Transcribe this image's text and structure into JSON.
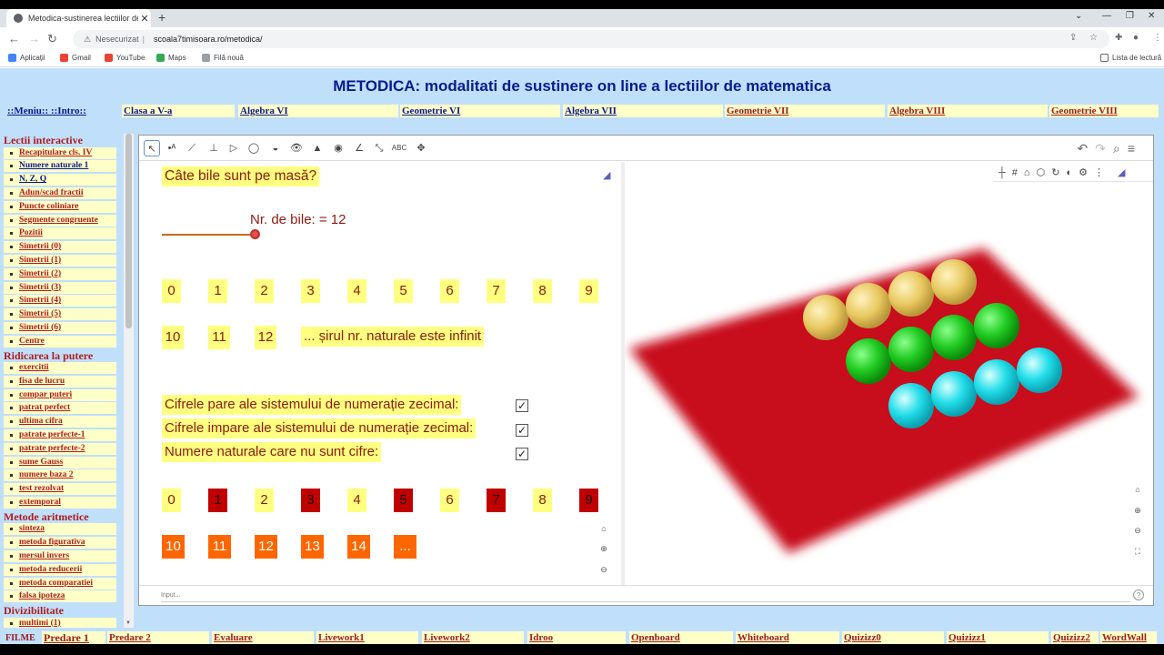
{
  "browser": {
    "tab_title": "Metodica-sustinerea lectiilor de",
    "omnibox_security": "Nesecurizat",
    "omnibox_url": "scoala7timisoara.ro/metodica/",
    "bookmarks": [
      "Aplicații",
      "Gmail",
      "YouTube",
      "Maps",
      "Filă nouă"
    ],
    "reading_list": "Lista de lectură"
  },
  "banner": "METODICA: modalitati de sustinere on line a lectiilor de matematica",
  "topnav": [
    {
      "label": "::Meniu:: ::Intro::",
      "color": "blue"
    },
    {
      "label": "Clasa a V-a",
      "color": "blue"
    },
    {
      "label": "Algebra VI",
      "color": "blue"
    },
    {
      "label": "Geometrie VI",
      "color": "blue"
    },
    {
      "label": "Algebra VII",
      "color": "blue"
    },
    {
      "label": "Geometrie VII",
      "color": "red"
    },
    {
      "label": "Algebra VIII",
      "color": "red"
    },
    {
      "label": "Geometrie VIII",
      "color": "red"
    }
  ],
  "sidebar": {
    "sections": [
      {
        "title": "Lectii interactive",
        "items": [
          {
            "label": "Recapitulare cls. IV",
            "color": "red"
          },
          {
            "label": "Numere naturale 1",
            "color": "blue"
          },
          {
            "label": "N, Z, Q",
            "color": "blue"
          },
          {
            "label": "Adun/scad fractii",
            "color": "red"
          },
          {
            "label": "Puncte coliniare",
            "color": "red"
          },
          {
            "label": "Segmente congruente",
            "color": "red"
          },
          {
            "label": "Pozitii",
            "color": "red"
          },
          {
            "label": "Simetrii (0)",
            "color": "red"
          },
          {
            "label": "Simetrii (1)",
            "color": "red"
          },
          {
            "label": "Simetrii (2)",
            "color": "red"
          },
          {
            "label": "Simetrii (3)",
            "color": "red"
          },
          {
            "label": "Simetrii (4)",
            "color": "red"
          },
          {
            "label": "Simetrii (5)",
            "color": "red"
          },
          {
            "label": "Simetrii (6)",
            "color": "red"
          },
          {
            "label": "Centre",
            "color": "red"
          }
        ]
      },
      {
        "title": "Ridicarea la putere",
        "items": [
          {
            "label": "exercitii",
            "color": "red"
          },
          {
            "label": "fisa de lucru",
            "color": "red"
          },
          {
            "label": "compar puteri",
            "color": "red"
          },
          {
            "label": "patrat perfect",
            "color": "red"
          },
          {
            "label": "ultima cifra",
            "color": "red"
          },
          {
            "label": "patrate perfecte-1",
            "color": "red"
          },
          {
            "label": "patrate perfecte-2",
            "color": "red"
          },
          {
            "label": "sume Gauss",
            "color": "red"
          },
          {
            "label": "numere baza 2",
            "color": "red"
          },
          {
            "label": "test rezolvat",
            "color": "red"
          },
          {
            "label": "extemporal",
            "color": "red"
          }
        ]
      },
      {
        "title": "Metode aritmetice",
        "items": [
          {
            "label": "sinteza",
            "color": "red"
          },
          {
            "label": "metoda figurativa",
            "color": "red"
          },
          {
            "label": "mersul invers",
            "color": "red"
          },
          {
            "label": "metoda reducerii",
            "color": "red"
          },
          {
            "label": "metoda comparatiei",
            "color": "red"
          },
          {
            "label": "falsa ipoteza",
            "color": "red"
          }
        ]
      },
      {
        "title": "Divizibilitate",
        "items": [
          {
            "label": "multimi (1)",
            "color": "red"
          }
        ]
      }
    ]
  },
  "applet": {
    "question": "Câte bile sunt pe masă?",
    "slider_label": "Nr. de bile: = 12",
    "slider_value": 12,
    "row1": [
      "0",
      "1",
      "2",
      "3",
      "4",
      "5",
      "6",
      "7",
      "8",
      "9"
    ],
    "row2": [
      "10",
      "11",
      "12"
    ],
    "infinite_text": "... șirul nr. naturale este infinit",
    "checkboxes": [
      {
        "label": "Cifrele pare ale sistemului de numerație zecimal:",
        "checked": true
      },
      {
        "label": "Cifrele impare ale sistemului de numerație zecimal:",
        "checked": true
      },
      {
        "label": "Numere naturale care nu sunt cifre:",
        "checked": true
      }
    ],
    "row3": [
      "0",
      "1",
      "2",
      "3",
      "4",
      "5",
      "6",
      "7",
      "8",
      "9"
    ],
    "row4": [
      "10",
      "11",
      "12",
      "13",
      "14",
      "..."
    ],
    "input_placeholder": "Input...",
    "colors": {
      "even": "#ffff80",
      "odd": "#c00000",
      "non_digit": "#ff6600",
      "table": "#c8101a"
    },
    "balls": {
      "yellow": 4,
      "green": 4,
      "cyan": 4,
      "yellow_color": "#e8c860",
      "green_color": "#22cc22",
      "cyan_color": "#22dde8"
    }
  },
  "bottomnav": {
    "prefix": "FILME",
    "items": [
      "Predare 1",
      "Predare 2",
      "Evaluare",
      "Livework1",
      "Livework2",
      "Idroo",
      "Openboard",
      "Whiteboard",
      "Quizizz0",
      "Quizizz1",
      "Quizizz2",
      "WordWall"
    ]
  }
}
